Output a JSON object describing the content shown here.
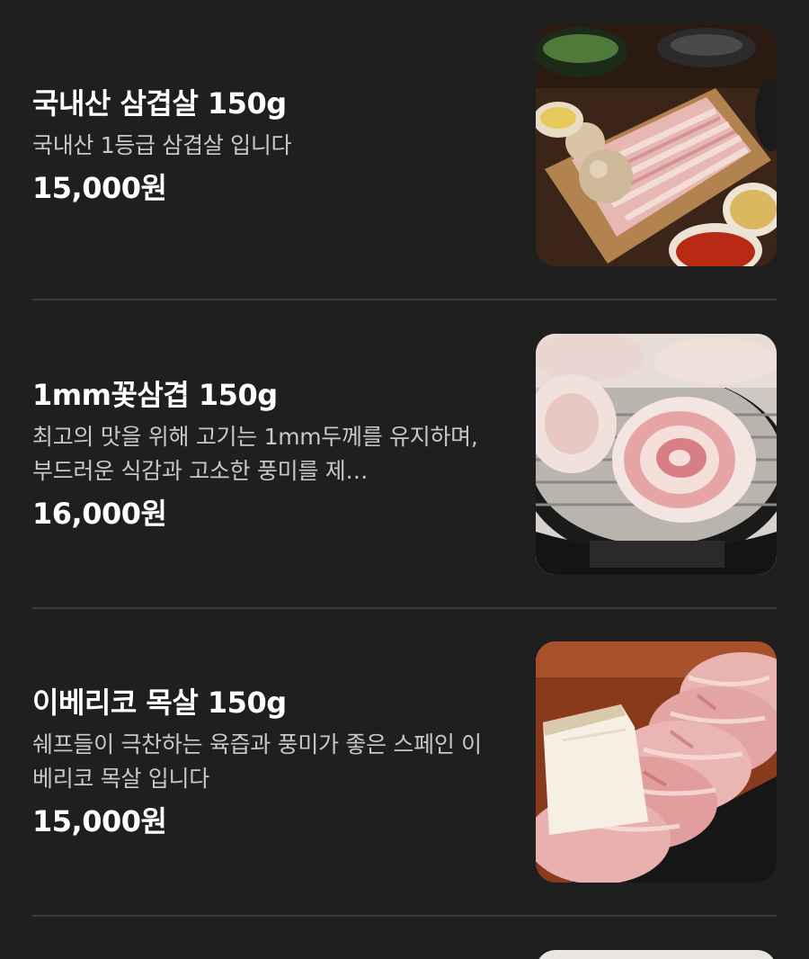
{
  "menu": {
    "items": [
      {
        "name": "국내산 삼겹살 150g",
        "description": "국내산 1등급 삼겹살 입니다",
        "price": "15,000원",
        "image_icon": "pork-belly-platter-photo"
      },
      {
        "name": "1mm꽃삼겹 150g",
        "description": "최고의 맛을 위해 고기는 1mm두께를 유지하며, 부드러운 식감과 고소한 풍미를 제…",
        "price": "16,000원",
        "image_icon": "grilled-pork-rolls-photo"
      },
      {
        "name": "이베리코 목살 150g",
        "description": "쉐프들이 극찬하는 육즙과 풍미가 좋은 스페인 이베리코 목살 입니다",
        "price": "15,000원",
        "image_icon": "iberico-neck-photo"
      }
    ]
  }
}
